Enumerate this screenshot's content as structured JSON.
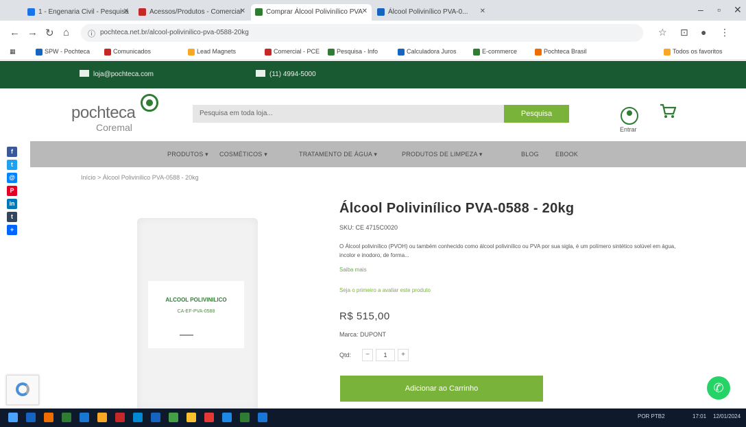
{
  "browser": {
    "tabs": [
      {
        "label": "1 - Engenaria Civil - Pesquisa",
        "active": false,
        "color": "#1a73e8"
      },
      {
        "label": "Acessos/Produtos - Comercial",
        "active": false,
        "color": "#c62828"
      },
      {
        "label": "Comprar Álcool Polivinílico PVA",
        "active": true,
        "color": "#2e7d32"
      },
      {
        "label": "Álcool Polivinílico PVA-0...",
        "active": false,
        "color": "#1565c0"
      }
    ],
    "url": "pochteca.net.br/alcool-polivinilico-pva-0588-20kg",
    "bookmarks": [
      {
        "label": "SPW - Pochteca",
        "color": "#1565c0"
      },
      {
        "label": "Comunicados",
        "color": "#c62828"
      },
      {
        "label": "Lead Magnets",
        "color": "#f9a825"
      },
      {
        "label": "Comercial - PCE",
        "color": "#c62828"
      },
      {
        "label": "Pesquisa - Info",
        "color": "#2e7d32"
      },
      {
        "label": "Calculadora Juros",
        "color": "#1565c0"
      },
      {
        "label": "E-commerce",
        "color": "#2e7d32"
      },
      {
        "label": "Pochteca Brasil",
        "color": "#ef6c00"
      },
      {
        "label": "Todos os favoritos",
        "color": "#f9a825"
      }
    ]
  },
  "topbar": {
    "email": "loja@pochteca.com",
    "phone": "(11) 4994-5000"
  },
  "header": {
    "logo_main": "pochteca",
    "logo_sub": "Coremal",
    "search_placeholder": "Pesquisa em toda loja...",
    "search_button": "Pesquisa",
    "user_label": "Entrar"
  },
  "nav": {
    "items": [
      "PRODUTOS ▾",
      "COSMÉTICOS ▾",
      "TRATAMENTO DE ÁGUA ▾",
      "PRODUTOS DE LIMPEZA ▾",
      "BLOG",
      "EBOOK"
    ]
  },
  "breadcrumb": "Início  >  Álcool Polivinílico PVA-0588 - 20kg",
  "share": [
    {
      "icon": "facebook-icon",
      "glyph": "f",
      "color": "#3b5998"
    },
    {
      "icon": "twitter-icon",
      "glyph": "t",
      "color": "#1da1f2"
    },
    {
      "icon": "email-icon",
      "glyph": "@",
      "color": "#0084ff"
    },
    {
      "icon": "pinterest-icon",
      "glyph": "P",
      "color": "#e60023"
    },
    {
      "icon": "linkedin-icon",
      "glyph": "in",
      "color": "#0077b5"
    },
    {
      "icon": "tumblr-icon",
      "glyph": "t",
      "color": "#35465c"
    },
    {
      "icon": "share-more-icon",
      "glyph": "+",
      "color": "#0066ff"
    }
  ],
  "product": {
    "image_title": "ALCOOL POLIVINILICO",
    "image_sub": "CA-EF-PVA-0588",
    "title": "Álcool Polivinílico PVA-0588 - 20kg",
    "sku": "SKU: CE 4715C0020",
    "description": "O Álcool polivinílico (PVOH) ou também conhecido como álcool polivinílico ou PVA por sua sigla, é um polímero sintético solúvel em água, incolor e inodoro, de forma...",
    "read_more": "Saiba mais",
    "note": "Seja o primeiro a avaliar este produto",
    "price": "R$ 515,00",
    "brand": "Marca: DUPONT",
    "qty_label": "Qtd:",
    "qty_value": "1",
    "add_to_cart": "Adicionar ao Carrinho"
  },
  "taskbar": {
    "icons": [
      "#1565c0",
      "#ef6c00",
      "#2e7d32",
      "#1976d2",
      "#f9a825",
      "#c62828",
      "#0288d1",
      "#1565c0",
      "#43a047",
      "#fbc02d",
      "#e53935",
      "#1e88e5",
      "#2e7d32",
      "#1976d2"
    ],
    "tray_text": "POR PTB2",
    "time": "17:01",
    "date": "12/01/2024"
  }
}
